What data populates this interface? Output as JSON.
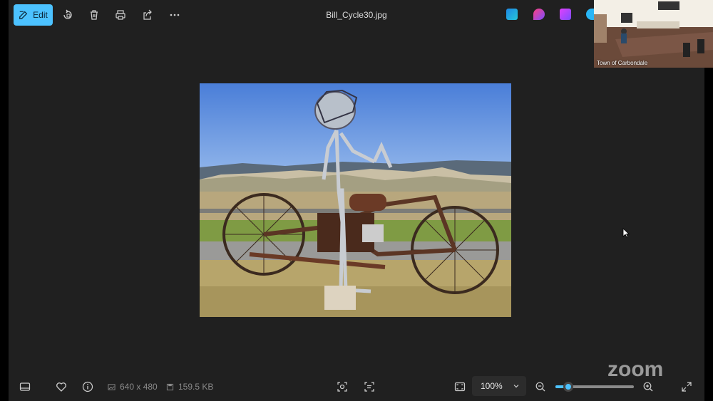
{
  "toolbar": {
    "edit_label": "Edit",
    "title": "Bill_Cycle30.jpg"
  },
  "bottombar": {
    "dimensions": "640 x 480",
    "file_size": "159.5 KB",
    "zoom_level": "100%",
    "zoom_slider_fraction": 0.16
  },
  "video": {
    "participant_name": "Town of Carbondale"
  },
  "overlay": {
    "brand": "zoom"
  },
  "colors": {
    "accent": "#4cc2ff",
    "background": "#202020"
  },
  "icons": [
    "edit-icon",
    "rotate-icon",
    "delete-icon",
    "print-icon",
    "share-icon",
    "more-icon",
    "filmstrip-icon",
    "favorite-icon",
    "info-icon",
    "dimensions-icon",
    "file-size-icon",
    "face-scan-icon",
    "ocr-icon",
    "fit-window-icon",
    "zoom-out-icon",
    "zoom-in-icon",
    "fullscreen-icon"
  ]
}
